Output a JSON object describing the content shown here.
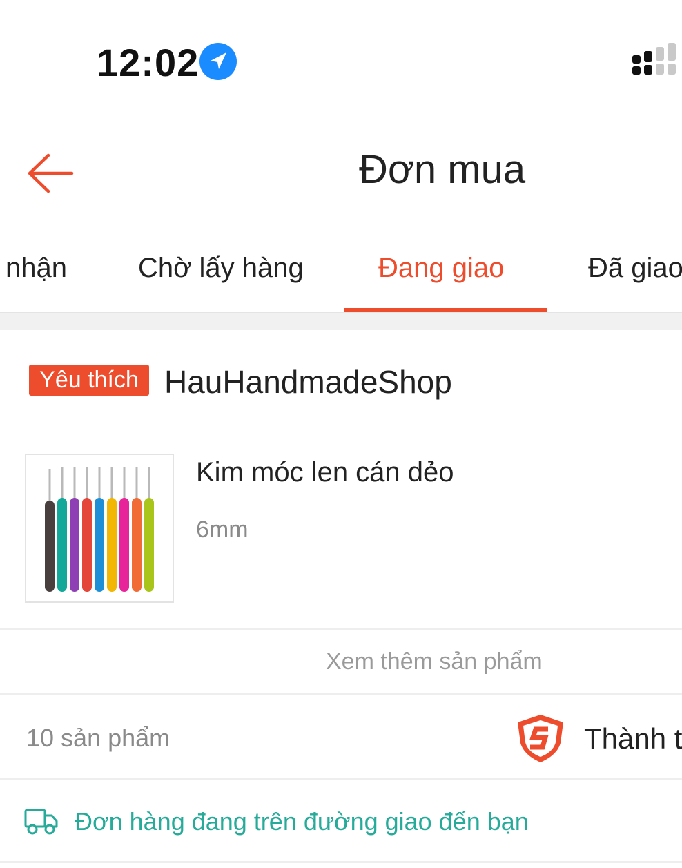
{
  "status_bar": {
    "time": "12:02",
    "icons": [
      "location-arrow-icon",
      "cellular-signal-icon"
    ]
  },
  "header": {
    "title": "Đơn mua",
    "back_icon": "arrow-left-icon"
  },
  "tabs": [
    {
      "label": "nhận",
      "active": false
    },
    {
      "label": "Chờ lấy hàng",
      "active": false
    },
    {
      "label": "Đang giao",
      "active": true
    },
    {
      "label": "Đã giao",
      "active": false
    }
  ],
  "order": {
    "shop_badge": "Yêu thích",
    "shop_name": "HauHandmadeShop",
    "product": {
      "name": "Kim móc len cán dẻo",
      "variant": "6mm",
      "image_icon": "crochet-hooks-image"
    },
    "see_more": "Xem thêm sản phẩm",
    "item_count": "10 sản phẩm",
    "total_label": "Thành t",
    "shipping_status": "Đơn hàng đang trên đường giao đến bạn"
  },
  "colors": {
    "accent": "#ee4d2d",
    "shipping_teal": "#26aa99",
    "location_blue": "#1a8cff"
  }
}
